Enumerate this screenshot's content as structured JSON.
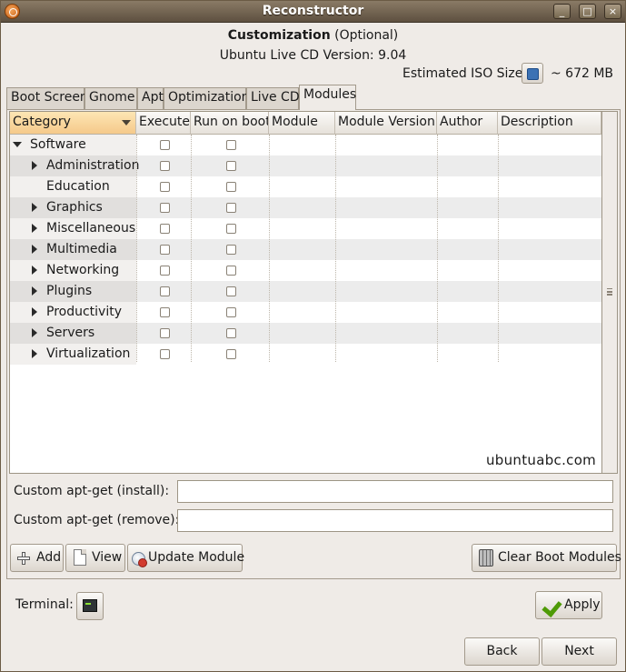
{
  "window": {
    "title": "Reconstructor"
  },
  "titlebar_buttons": {
    "minimize": "_",
    "maximize": "□",
    "close": "×"
  },
  "header": {
    "title_bold": "Customization",
    "title_rest": " (Optional)",
    "version": "Ubuntu Live CD Version: 9.04",
    "iso_label": "Estimated ISO Size:",
    "iso_value": "~ 672 MB"
  },
  "tabs": [
    {
      "label": "Boot Screen"
    },
    {
      "label": "Gnome"
    },
    {
      "label": "Apt"
    },
    {
      "label": "Optimization"
    },
    {
      "label": "Live CD"
    },
    {
      "label": "Modules",
      "active": true
    }
  ],
  "tree": {
    "columns": [
      "Category",
      "Execute",
      "Run on boot",
      "Module",
      "Module Version",
      "Author",
      "Description"
    ],
    "sorted_column": "Category",
    "rows": [
      {
        "label": "Software",
        "level": 0,
        "expander": "expanded",
        "execute": false,
        "run_on_boot": false
      },
      {
        "label": "Administration",
        "level": 1,
        "expander": "collapsed",
        "execute": false,
        "run_on_boot": false
      },
      {
        "label": "Education",
        "level": 1,
        "expander": "none",
        "execute": false,
        "run_on_boot": false
      },
      {
        "label": "Graphics",
        "level": 1,
        "expander": "collapsed",
        "execute": false,
        "run_on_boot": false
      },
      {
        "label": "Miscellaneous",
        "level": 1,
        "expander": "collapsed",
        "execute": false,
        "run_on_boot": false
      },
      {
        "label": "Multimedia",
        "level": 1,
        "expander": "collapsed",
        "execute": false,
        "run_on_boot": false
      },
      {
        "label": "Networking",
        "level": 1,
        "expander": "collapsed",
        "execute": false,
        "run_on_boot": false
      },
      {
        "label": "Plugins",
        "level": 1,
        "expander": "collapsed",
        "execute": false,
        "run_on_boot": false
      },
      {
        "label": "Productivity",
        "level": 1,
        "expander": "collapsed",
        "execute": false,
        "run_on_boot": false
      },
      {
        "label": "Servers",
        "level": 1,
        "expander": "collapsed",
        "execute": false,
        "run_on_boot": false
      },
      {
        "label": "Virtualization",
        "level": 1,
        "expander": "collapsed",
        "execute": false,
        "run_on_boot": false
      }
    ]
  },
  "watermark": "ubuntuabc.com",
  "fields": {
    "install_label": "Custom apt-get (install):",
    "install_value": "",
    "remove_label": "Custom apt-get (remove):",
    "remove_value": ""
  },
  "module_buttons": {
    "add": "Add",
    "view": "View",
    "update": "Update Module",
    "clear": "Clear Boot Modules"
  },
  "footer": {
    "terminal_label": "Terminal:",
    "apply": "Apply",
    "back": "Back",
    "next": "Next"
  },
  "icons": {
    "window": "app-icon",
    "iso_refresh": "refresh-icon",
    "add": "plus-icon",
    "view": "document-icon",
    "update": "update-icon",
    "clear": "trash-icon",
    "terminal": "terminal-icon",
    "apply": "checkmark-icon"
  },
  "colors": {
    "titlebar": "#6f6150",
    "window_bg": "#efebe7",
    "sorted_header": "#f5c98a",
    "alt_row": "#ececec",
    "apply_check": "#4e9a06"
  }
}
